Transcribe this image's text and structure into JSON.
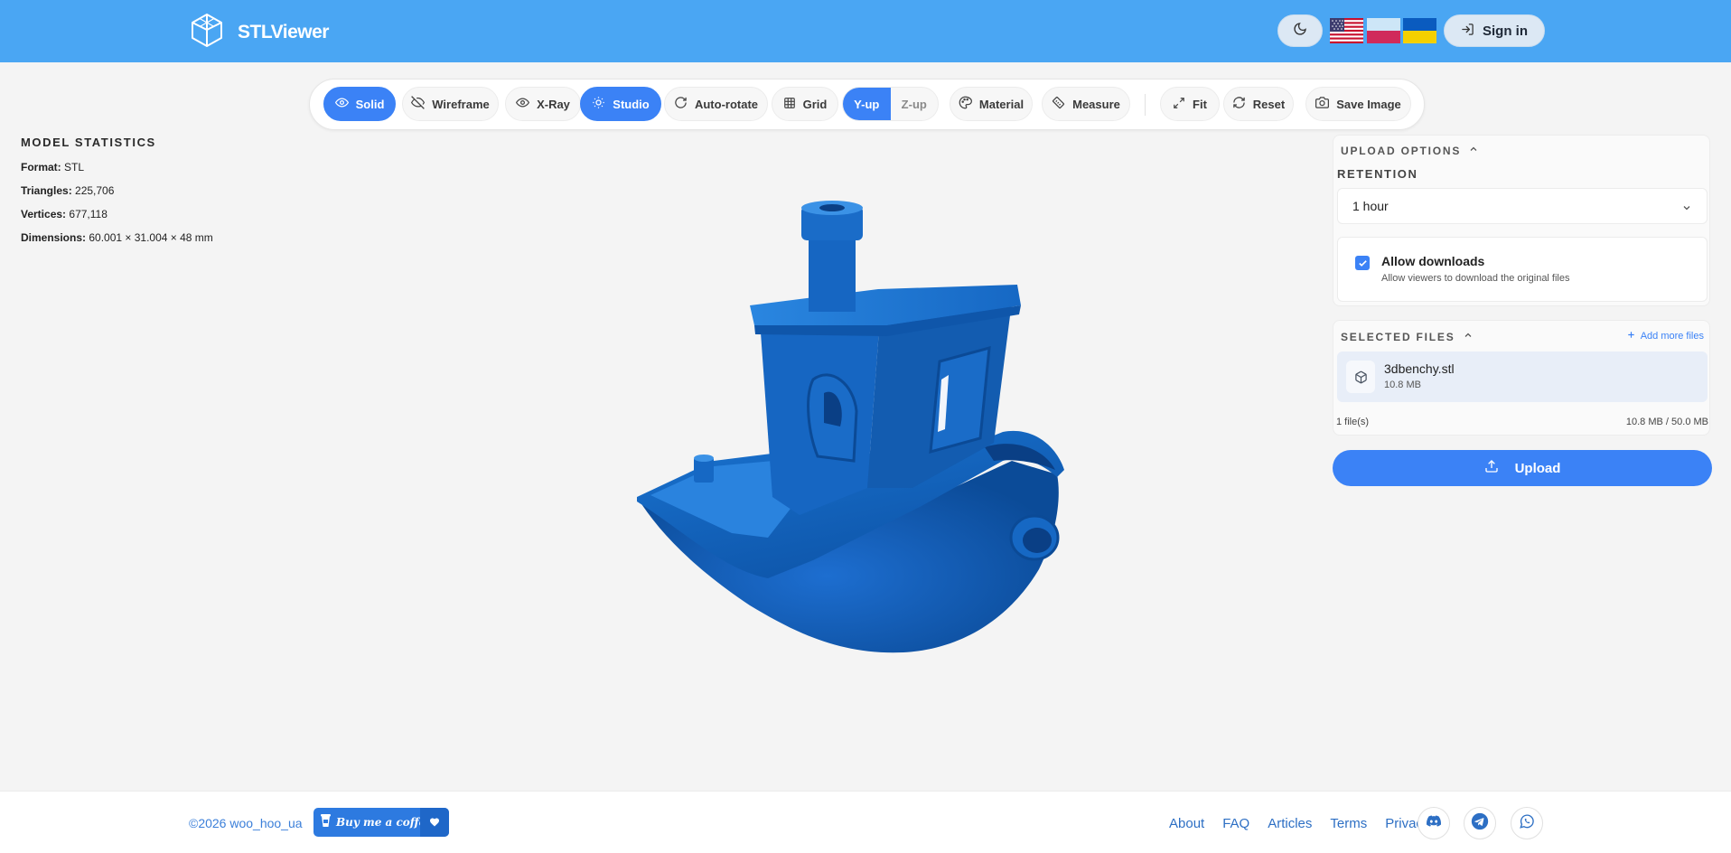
{
  "header": {
    "brand": "STLViewer",
    "theme_icon": "moon-icon",
    "flags": [
      "us-flag",
      "pl-flag",
      "ua-flag"
    ],
    "sign_in_label": "Sign in"
  },
  "toolbar": {
    "buttons": [
      {
        "label": "Solid",
        "icon": "eye-icon",
        "active": true
      },
      {
        "label": "Wireframe",
        "icon": "eye-off-icon",
        "active": false
      },
      {
        "label": "X-Ray",
        "icon": "eye-icon",
        "active": false
      },
      {
        "label": "Studio",
        "icon": "sun-icon",
        "active": true
      },
      {
        "label": "Auto-rotate",
        "icon": "rotate-icon",
        "active": false
      },
      {
        "label": "Grid",
        "icon": "grid-icon",
        "active": false
      },
      {
        "label": "Material",
        "icon": "palette-icon",
        "active": false
      },
      {
        "label": "Measure",
        "icon": "ruler-icon",
        "active": false
      },
      {
        "label": "Fit",
        "icon": "expand-icon",
        "active": false
      },
      {
        "label": "Reset",
        "icon": "refresh-icon",
        "active": false
      },
      {
        "label": "Save Image",
        "icon": "camera-icon",
        "active": false
      }
    ],
    "axis": {
      "y_up": "Y-up",
      "z_up": "Z-up",
      "selected": "Y-up"
    }
  },
  "stats": {
    "title": "MODEL STATISTICS",
    "format_label": "Format:",
    "format": "STL",
    "triangles_label": "Triangles:",
    "triangles": "225,706",
    "vertices_label": "Vertices:",
    "vertices": "677,118",
    "dimensions_label": "Dimensions:",
    "dimensions": "60.001 × 31.004 × 48 mm"
  },
  "panel": {
    "upload_options": "UPLOAD OPTIONS",
    "retention_label": "RETENTION",
    "retention_value": "1 hour",
    "allow_downloads": {
      "checked": true,
      "title": "Allow downloads",
      "description": "Allow viewers to download the original files"
    },
    "selected_files": "SELECTED FILES",
    "add_more": "Add more files",
    "files": [
      {
        "name": "3dbenchy.stl",
        "size": "10.8 MB"
      }
    ],
    "files_count": "1 file(s)",
    "files_total": "10.8 MB / 50.0 MB",
    "upload_label": "Upload"
  },
  "footer": {
    "copyright": "©2026 woo_hoo_ua",
    "coffee": "Buy me a coffee",
    "links": [
      "About",
      "FAQ",
      "Articles",
      "Terms",
      "Privacy"
    ],
    "social": [
      "discord-icon",
      "telegram-icon",
      "whatsapp-icon"
    ]
  },
  "colors": {
    "header": "#4aa6f3",
    "accent": "#3b82f6",
    "model": "#1565c0",
    "background": "#f4f4f4"
  }
}
